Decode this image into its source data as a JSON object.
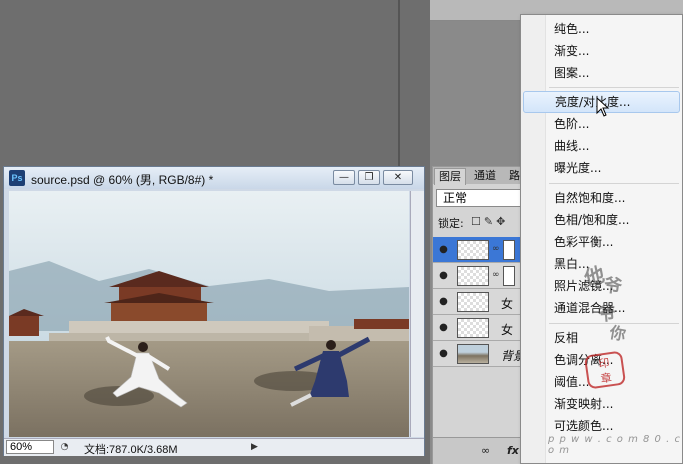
{
  "document": {
    "title": "source.psd @ 60% (男, RGB/8#) *",
    "app_badge": "Ps",
    "minimize": "—",
    "restore": "❐",
    "close": "✕",
    "zoom": "60%",
    "doc_info": "文档:787.0K/3.68M"
  },
  "layers_panel": {
    "tabs": [
      "图层",
      "通道",
      "路"
    ],
    "blend_mode": "正常",
    "lock_label": "锁定:",
    "layers": [
      {
        "name": "",
        "selected": true,
        "has_mask": true
      },
      {
        "name": "",
        "selected": false,
        "has_mask": true
      },
      {
        "name": "女",
        "selected": false,
        "has_mask": false
      },
      {
        "name": "女 ",
        "selected": false,
        "has_mask": false
      },
      {
        "name": "背景",
        "selected": false,
        "has_mask": false
      }
    ]
  },
  "menu": {
    "items": [
      "纯色...",
      "渐变...",
      "图案...",
      "亮度/对比度...",
      "色阶...",
      "曲线...",
      "曝光度...",
      "自然饱和度...",
      "色相/饱和度...",
      "色彩平衡...",
      "黑白...",
      "照片滤镜...",
      "通道混合器...",
      "反相",
      "色调分离...",
      "阈值...",
      "渐变映射...",
      "可选颜色..."
    ],
    "hovered": "亮度/对比度..."
  },
  "watermark": {
    "text": "他爷爷你",
    "url": "p p w w . c o m 8 0 . c o m"
  }
}
